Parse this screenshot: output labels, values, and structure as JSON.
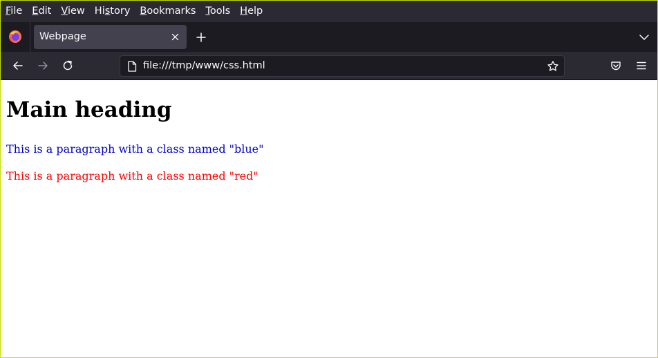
{
  "menubar": {
    "items": [
      {
        "acc": "F",
        "rest": "ile"
      },
      {
        "acc": "E",
        "rest": "dit"
      },
      {
        "acc": "V",
        "rest": "iew"
      },
      {
        "pre": "Hi",
        "acc": "s",
        "rest": "tory"
      },
      {
        "acc": "B",
        "rest": "ookmarks"
      },
      {
        "acc": "T",
        "rest": "ools"
      },
      {
        "acc": "H",
        "rest": "elp"
      }
    ]
  },
  "tabs": {
    "active_title": "Webpage"
  },
  "navbar": {
    "url": "file:///tmp/www/css.html"
  },
  "page": {
    "heading": "Main heading",
    "paragraph_blue": "This is a paragraph with a class named \"blue\"",
    "paragraph_red": "This is a paragraph with a class named \"red\""
  },
  "colors": {
    "chrome_dark": "#2b2a33",
    "tabstrip": "#1c1b22",
    "active_tab": "#42414d",
    "text_blue": "#0000cc",
    "text_red": "#ff0000"
  }
}
